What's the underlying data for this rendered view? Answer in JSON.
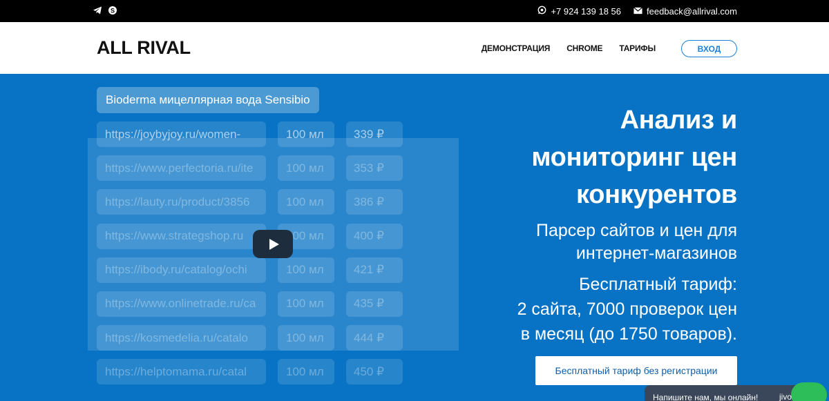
{
  "topbar": {
    "social": [
      {
        "icon": "telegram-icon"
      },
      {
        "icon": "skype-icon"
      }
    ],
    "phone": "+7 924 139 18 56",
    "email": "feedback@allrival.com"
  },
  "header": {
    "logo": "ALL RIVAL",
    "nav": [
      "ДЕМОНСТРАЦИЯ",
      "CHROME",
      "ТАРИФЫ"
    ],
    "login": "ВХОД"
  },
  "demo": {
    "product": "Bioderma мицеллярная вода Sensibio",
    "rows": [
      {
        "url": "https://joybyjoy.ru/women-",
        "volume": "100 мл",
        "price": "339 ₽"
      },
      {
        "url": "https://www.perfectoria.ru/ite",
        "volume": "100 мл",
        "price": "353 ₽"
      },
      {
        "url": "https://lauty.ru/product/3856",
        "volume": "100 мл",
        "price": "386 ₽"
      },
      {
        "url": "https://www.strategshop.ru",
        "volume": "100 мл",
        "price": "400 ₽"
      },
      {
        "url": "https://ibody.ru/catalog/ochi",
        "volume": "100 мл",
        "price": "421 ₽"
      },
      {
        "url": "https://www.onlinetrade.ru/ca",
        "volume": "100 мл",
        "price": "435 ₽"
      },
      {
        "url": "https://kosmedelia.ru/catalo",
        "volume": "100 мл",
        "price": "444 ₽"
      },
      {
        "url": "https://helptomama.ru/catal",
        "volume": "100 мл",
        "price": "450 ₽"
      }
    ]
  },
  "hero": {
    "title_lines": [
      "Анализ и",
      "мониторинг цен",
      "конкурентов"
    ],
    "subtitle_lines": [
      "Парсер сайтов и цен для",
      "интернет-магазинов"
    ],
    "free_lines": [
      "Бесплатный тариф:",
      "2 сайта, 7000 проверок цен",
      "в месяц (до 1750 товаров)."
    ],
    "cta": "Бесплатный тариф без регистрации"
  },
  "chat": {
    "text": "Напишите нам, мы онлайн!",
    "brand": "jivo"
  },
  "colors": {
    "hero_bg": "#0873c4",
    "accent": "#1a7fd6",
    "topbar_bg": "#000000",
    "chat_green": "#2dbd59"
  }
}
